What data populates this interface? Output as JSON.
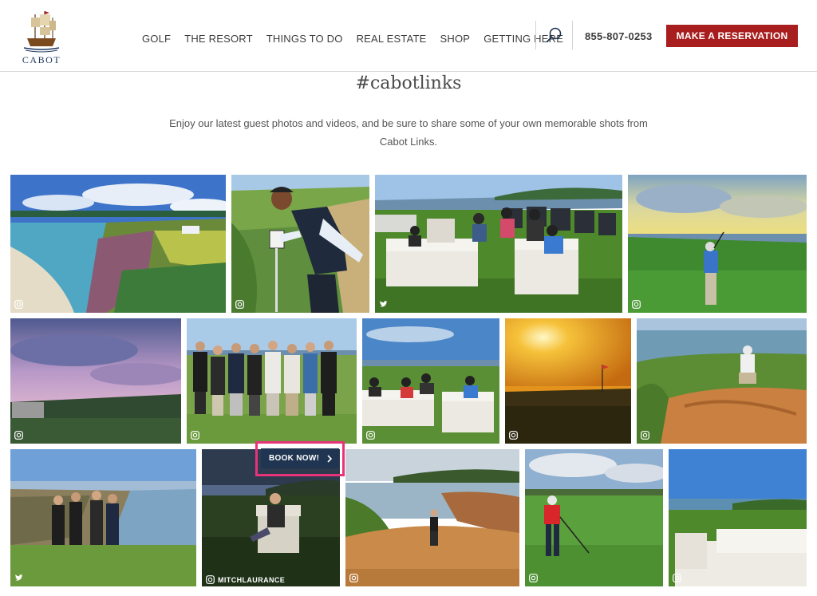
{
  "brand": {
    "logo_text": "CABOT",
    "accent_color": "#a81d1d"
  },
  "nav": {
    "items": [
      "GOLF",
      "THE RESORT",
      "THINGS TO DO",
      "REAL ESTATE",
      "SHOP",
      "GETTING HERE"
    ],
    "search_icon": "search-icon",
    "phone": "855-807-0253",
    "cta_label": "MAKE A RESERVATION"
  },
  "feed": {
    "title": "#cabotlinks",
    "intro": "Enjoy our latest guest photos and videos, and be sure to share some of your own memorable shots from Cabot Links.",
    "handle": "MITCHLAURANCE",
    "book_now_label": "BOOK NOW!",
    "tiles": [
      {
        "scene": "coastal-cliffs-aerial",
        "source": "instagram"
      },
      {
        "scene": "golfer-with-hole-sign",
        "source": "instagram"
      },
      {
        "scene": "lounge-seating-golf-carts",
        "source": "twitter"
      },
      {
        "scene": "golfer-swing-sunset-sky",
        "source": "instagram"
      },
      {
        "scene": "purple-dusk-hotel",
        "source": "instagram"
      },
      {
        "scene": "group-of-golfers",
        "source": "instagram"
      },
      {
        "scene": "guests-on-lounge-sofas",
        "source": "instagram"
      },
      {
        "scene": "golden-sunset-flag",
        "source": "instagram"
      },
      {
        "scene": "bunker-shot-sand",
        "source": "instagram"
      },
      {
        "scene": "four-golfers-clifftop",
        "source": "twitter"
      },
      {
        "scene": "man-in-chair-dusk",
        "source": "instagram"
      },
      {
        "scene": "golfer-bunker-cove",
        "source": "instagram"
      },
      {
        "scene": "golfer-red-shirt-tee",
        "source": "instagram"
      },
      {
        "scene": "white-sofa-ocean-view",
        "source": "instagram"
      }
    ]
  }
}
